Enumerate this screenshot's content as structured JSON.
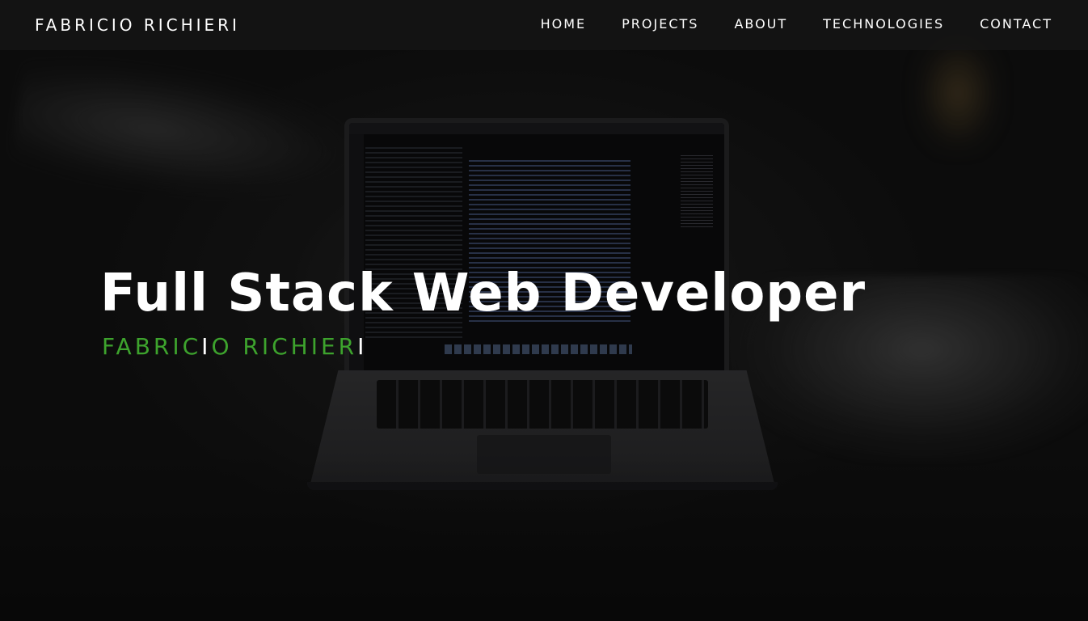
{
  "nav": {
    "brand": "FABRICIO RICHIERI",
    "links": [
      "HOME",
      "PROJECTS",
      "ABOUT",
      "TECHNOLOGIES",
      "CONTACT"
    ]
  },
  "hero": {
    "headline": "Full Stack Web Developer",
    "subline_part1": "FABRIC",
    "subline_part2": "I",
    "subline_part3": "O RICHIER",
    "subline_part4": "I",
    "accent_color": "#3da32d",
    "background_image": "dark photo of an open laptop showing a code editor on a concrete surface"
  }
}
